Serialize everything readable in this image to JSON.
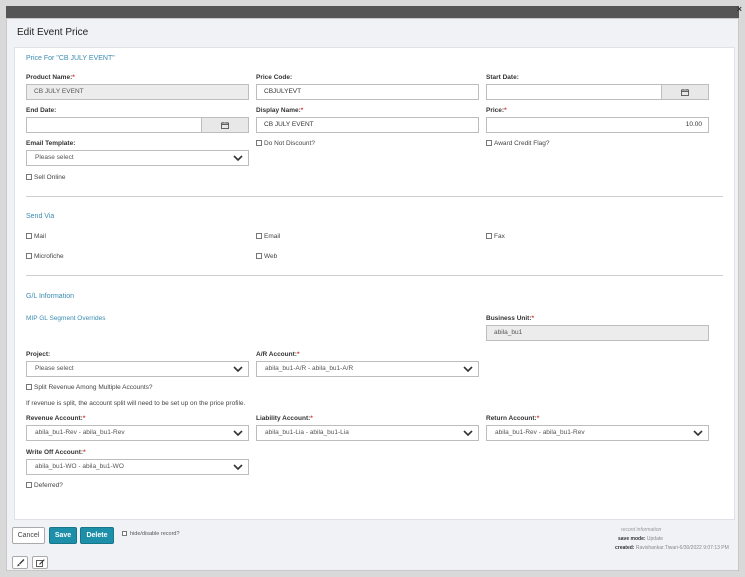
{
  "window": {
    "close_glyph": "×"
  },
  "dialog": {
    "title": "Edit Event Price"
  },
  "price_section": {
    "title": "Price For \"CB JULY EVENT\"",
    "product_name": {
      "label": "Product Name:",
      "value": "CB JULY EVENT"
    },
    "price_code": {
      "label": "Price Code:",
      "value": "CBJULYEVT"
    },
    "start_date": {
      "label": "Start Date:",
      "value": ""
    },
    "end_date": {
      "label": "End Date:",
      "value": ""
    },
    "display_name": {
      "label": "Display Name:",
      "value": "CB JULY EVENT"
    },
    "price": {
      "label": "Price:",
      "value": "10.00"
    },
    "email_template": {
      "label": "Email Template:",
      "value": "Please select"
    },
    "do_not_discount": {
      "label": "Do Not Discount?",
      "checked": false
    },
    "award_credit_flag": {
      "label": "Award Credit Flag?",
      "checked": false
    },
    "sell_online": {
      "label": "Sell Online",
      "checked": false
    }
  },
  "send_via": {
    "title": "Send Via",
    "mail": "Mail",
    "email": "Email",
    "fax": "Fax",
    "microfiche": "Microfiche",
    "web": "Web"
  },
  "gl_section": {
    "title": "G/L Information",
    "mip_link": "MIP GL Segment Overrides",
    "business_unit": {
      "label": "Business Unit:",
      "value": "abila_bu1"
    },
    "project": {
      "label": "Project:",
      "value": "Please select"
    },
    "ar_account": {
      "label": "A/R Account:",
      "value": "abila_bu1-A/R - abila_bu1-A/R"
    },
    "split_revenue": {
      "label": "Split Revenue Among Multiple Accounts?",
      "checked": false
    },
    "split_note": "If revenue is split, the account split will need to be set up on the price profile.",
    "revenue_account": {
      "label": "Revenue Account:",
      "value": "abila_bu1-Rev - abila_bu1-Rev"
    },
    "liability_account": {
      "label": "Liability Account:",
      "value": "abila_bu1-Lia - abila_bu1-Lia"
    },
    "return_account": {
      "label": "Return Account:",
      "value": "abila_bu1-Rev - abila_bu1-Rev"
    },
    "write_off_account": {
      "label": "Write Off Account:",
      "value": "abila_bu1-WO - abila_bu1-WO"
    },
    "deferred": {
      "label": "Deferred?",
      "checked": false
    }
  },
  "footer": {
    "cancel_label": "Cancel",
    "save_label": "Save",
    "delete_label": "Delete",
    "hide_disable_label": "hide/disable record?",
    "record_info_title": "record information",
    "save_mode_label": "save mode:",
    "save_mode_value": "Update",
    "created_label": "created:",
    "created_value": "Ravishankar.Tiwari-6/30/2022 9:07:13 PM"
  },
  "toolbar": {
    "icons": [
      "brush-icon",
      "edit-icon"
    ]
  },
  "colors": {
    "accent": "#1e8fa8",
    "section_title": "#3a8bb0",
    "required": "#d9342b"
  }
}
